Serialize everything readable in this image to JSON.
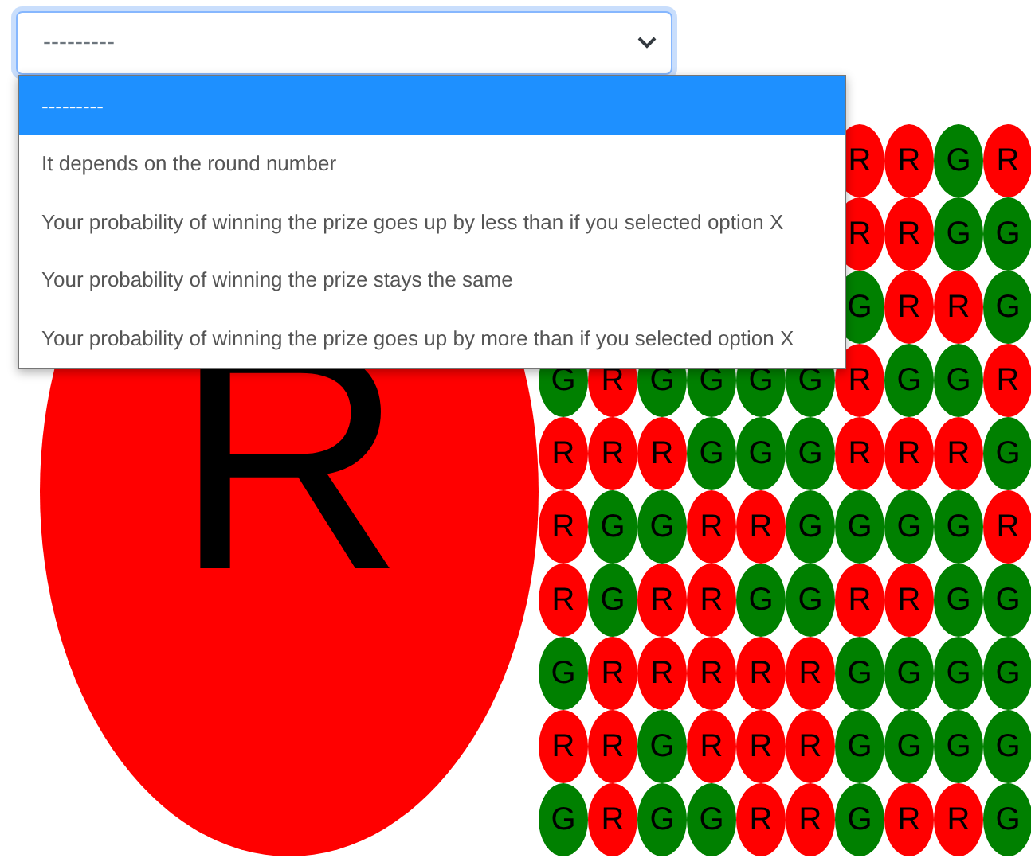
{
  "select": {
    "value": "---------",
    "options": [
      {
        "label": "---------",
        "selected": true
      },
      {
        "label": "It depends on the round number",
        "selected": false
      },
      {
        "label": "Your probability of winning the prize goes up by less than if you selected option X",
        "selected": false
      },
      {
        "label": "Your probability of winning the prize stays the same",
        "selected": false
      },
      {
        "label": "Your probability of winning the prize goes up by more than if you selected option X",
        "selected": false
      }
    ]
  },
  "big_token": {
    "letter": "R",
    "color": "#ff0000"
  },
  "grid": [
    [
      {
        "letter": "R",
        "color": "#ff0000"
      },
      {
        "letter": "R",
        "color": "#ff0000"
      },
      {
        "letter": "G",
        "color": "#008000"
      },
      {
        "letter": "R",
        "color": "#ff0000"
      }
    ],
    [
      {
        "letter": "R",
        "color": "#ff0000"
      },
      {
        "letter": "R",
        "color": "#ff0000"
      },
      {
        "letter": "G",
        "color": "#008000"
      },
      {
        "letter": "G",
        "color": "#008000"
      }
    ],
    [
      {
        "letter": "G",
        "color": "#008000"
      },
      {
        "letter": "R",
        "color": "#ff0000"
      },
      {
        "letter": "R",
        "color": "#ff0000"
      },
      {
        "letter": "G",
        "color": "#008000"
      }
    ],
    [
      {
        "letter": "G",
        "color": "#008000"
      },
      {
        "letter": "R",
        "color": "#ff0000"
      },
      {
        "letter": "G",
        "color": "#008000"
      },
      {
        "letter": "G",
        "color": "#008000"
      },
      {
        "letter": "G",
        "color": "#008000"
      },
      {
        "letter": "G",
        "color": "#008000"
      },
      {
        "letter": "R",
        "color": "#ff0000"
      },
      {
        "letter": "G",
        "color": "#008000"
      },
      {
        "letter": "G",
        "color": "#008000"
      },
      {
        "letter": "R",
        "color": "#ff0000"
      }
    ],
    [
      {
        "letter": "R",
        "color": "#ff0000"
      },
      {
        "letter": "R",
        "color": "#ff0000"
      },
      {
        "letter": "R",
        "color": "#ff0000"
      },
      {
        "letter": "G",
        "color": "#008000"
      },
      {
        "letter": "G",
        "color": "#008000"
      },
      {
        "letter": "G",
        "color": "#008000"
      },
      {
        "letter": "R",
        "color": "#ff0000"
      },
      {
        "letter": "R",
        "color": "#ff0000"
      },
      {
        "letter": "R",
        "color": "#ff0000"
      },
      {
        "letter": "G",
        "color": "#008000"
      }
    ],
    [
      {
        "letter": "R",
        "color": "#ff0000"
      },
      {
        "letter": "G",
        "color": "#008000"
      },
      {
        "letter": "G",
        "color": "#008000"
      },
      {
        "letter": "R",
        "color": "#ff0000"
      },
      {
        "letter": "R",
        "color": "#ff0000"
      },
      {
        "letter": "G",
        "color": "#008000"
      },
      {
        "letter": "G",
        "color": "#008000"
      },
      {
        "letter": "G",
        "color": "#008000"
      },
      {
        "letter": "G",
        "color": "#008000"
      },
      {
        "letter": "R",
        "color": "#ff0000"
      }
    ],
    [
      {
        "letter": "R",
        "color": "#ff0000"
      },
      {
        "letter": "G",
        "color": "#008000"
      },
      {
        "letter": "R",
        "color": "#ff0000"
      },
      {
        "letter": "R",
        "color": "#ff0000"
      },
      {
        "letter": "G",
        "color": "#008000"
      },
      {
        "letter": "G",
        "color": "#008000"
      },
      {
        "letter": "R",
        "color": "#ff0000"
      },
      {
        "letter": "R",
        "color": "#ff0000"
      },
      {
        "letter": "G",
        "color": "#008000"
      },
      {
        "letter": "G",
        "color": "#008000"
      }
    ],
    [
      {
        "letter": "G",
        "color": "#008000"
      },
      {
        "letter": "R",
        "color": "#ff0000"
      },
      {
        "letter": "R",
        "color": "#ff0000"
      },
      {
        "letter": "R",
        "color": "#ff0000"
      },
      {
        "letter": "R",
        "color": "#ff0000"
      },
      {
        "letter": "R",
        "color": "#ff0000"
      },
      {
        "letter": "G",
        "color": "#008000"
      },
      {
        "letter": "G",
        "color": "#008000"
      },
      {
        "letter": "G",
        "color": "#008000"
      },
      {
        "letter": "G",
        "color": "#008000"
      }
    ],
    [
      {
        "letter": "R",
        "color": "#ff0000"
      },
      {
        "letter": "R",
        "color": "#ff0000"
      },
      {
        "letter": "G",
        "color": "#008000"
      },
      {
        "letter": "R",
        "color": "#ff0000"
      },
      {
        "letter": "R",
        "color": "#ff0000"
      },
      {
        "letter": "R",
        "color": "#ff0000"
      },
      {
        "letter": "G",
        "color": "#008000"
      },
      {
        "letter": "G",
        "color": "#008000"
      },
      {
        "letter": "G",
        "color": "#008000"
      },
      {
        "letter": "G",
        "color": "#008000"
      }
    ],
    [
      {
        "letter": "G",
        "color": "#008000"
      },
      {
        "letter": "R",
        "color": "#ff0000"
      },
      {
        "letter": "G",
        "color": "#008000"
      },
      {
        "letter": "G",
        "color": "#008000"
      },
      {
        "letter": "R",
        "color": "#ff0000"
      },
      {
        "letter": "R",
        "color": "#ff0000"
      },
      {
        "letter": "G",
        "color": "#008000"
      },
      {
        "letter": "R",
        "color": "#ff0000"
      },
      {
        "letter": "R",
        "color": "#ff0000"
      },
      {
        "letter": "G",
        "color": "#008000"
      }
    ]
  ]
}
